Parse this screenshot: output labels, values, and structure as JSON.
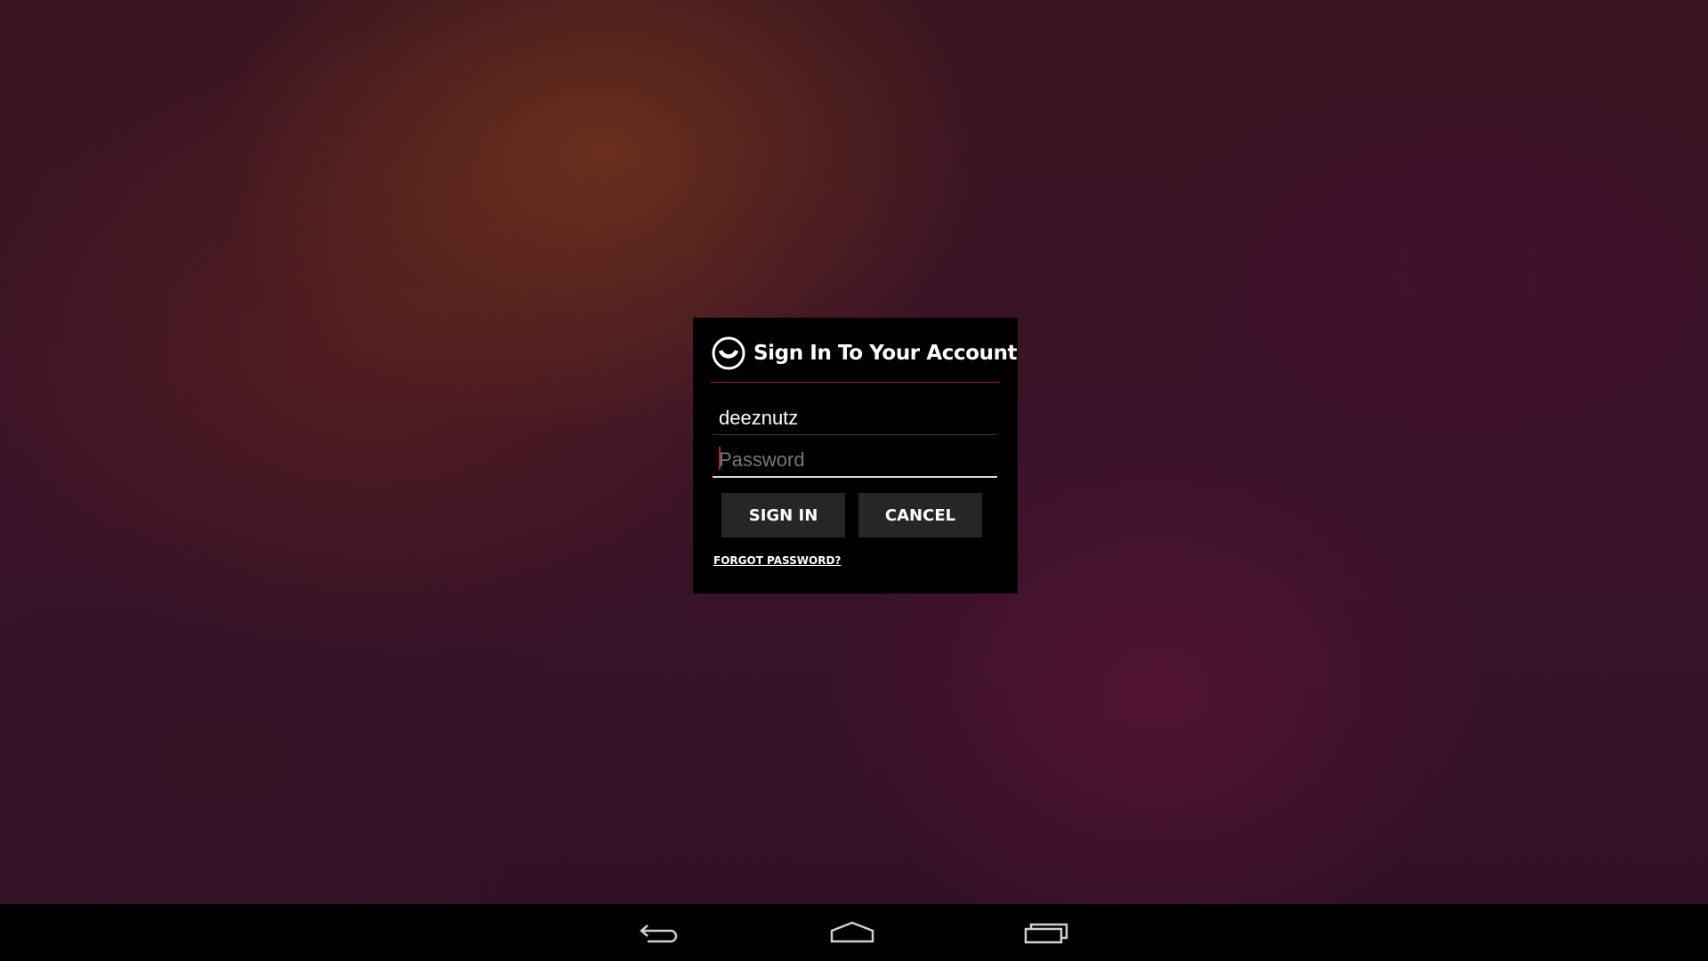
{
  "dialog": {
    "title": "Sign In To Your Account",
    "logo_icon": "ring-logo-icon",
    "username": {
      "value": "deeznutz"
    },
    "password": {
      "value": "",
      "placeholder": "Password"
    },
    "sign_in_label": "SIGN IN",
    "cancel_label": "CANCEL",
    "forgot_label": "FORGOT PASSWORD?",
    "accent_color": "#b0232b"
  },
  "navbar": {
    "back_icon": "back-arrow-icon",
    "home_icon": "home-icon",
    "recents_icon": "recent-apps-icon"
  }
}
